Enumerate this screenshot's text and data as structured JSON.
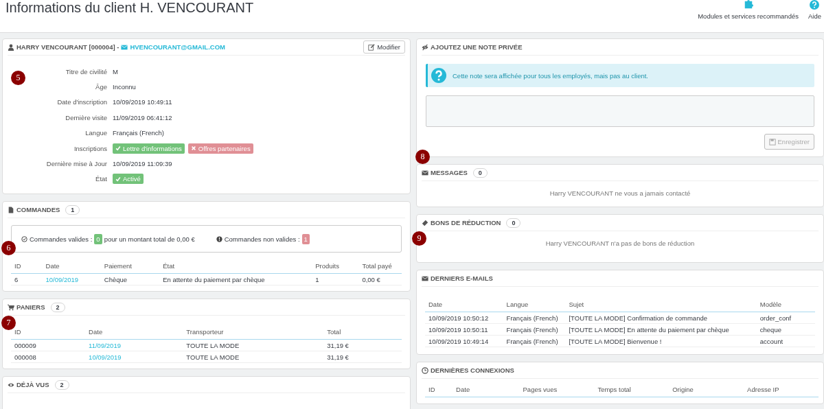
{
  "page": {
    "title": "Informations du client H. VENCOURANT",
    "toolbar": [
      {
        "kind": "puzzle",
        "label": "Modules et services recommandés"
      },
      {
        "kind": "help",
        "label": "Aide"
      }
    ]
  },
  "customer": {
    "name": "HARRY VENCOURANT [000004] -",
    "email": "HVENCOURANT@GMAIL.COM",
    "edit_button": "Modifier",
    "marker": "5",
    "fields": [
      {
        "label": "Titre de civilité",
        "kind": "text",
        "value": "M"
      },
      {
        "label": "Âge",
        "kind": "text",
        "value": "Inconnu"
      },
      {
        "label": "Date d'inscription",
        "kind": "text",
        "value": "10/09/2019 10:49:11"
      },
      {
        "label": "Dernière visite",
        "kind": "text",
        "value": "11/09/2019 06:41:12"
      },
      {
        "label": "Langue",
        "kind": "text",
        "value": "Français (French)"
      },
      {
        "label": "Inscriptions",
        "kind": "badges",
        "badges": [
          {
            "text": "Lettre d'informations",
            "on": true
          },
          {
            "text": "Offres partenaires",
            "on": false
          }
        ]
      },
      {
        "label": "Dernière mise à Jour",
        "kind": "text",
        "value": "10/09/2019 11:09:39"
      },
      {
        "label": "État",
        "kind": "badges",
        "badges": [
          {
            "text": "Activé",
            "on": true
          }
        ]
      }
    ]
  },
  "orders": {
    "title": "COMMANDES",
    "count": "1",
    "marker": "6",
    "valid_label": "Commandes valides :",
    "valid_count": "0",
    "valid_total": "pour un montant total de 0,00 €",
    "invalid_label": "Commandes non valides :",
    "invalid_count": "1",
    "columns": [
      {
        "label": "ID",
        "kind": "text"
      },
      {
        "label": "Date",
        "kind": "link"
      },
      {
        "label": "Paiement",
        "kind": "text"
      },
      {
        "label": "État",
        "kind": "text"
      },
      {
        "label": "Produits",
        "kind": "text"
      },
      {
        "label": "Total payé",
        "kind": "text"
      }
    ],
    "rows": [
      [
        "6",
        "10/09/2019",
        "Chèque",
        "En attente du paiement par chèque",
        "1",
        "0,00 €"
      ]
    ]
  },
  "carts": {
    "title": "PANIERS",
    "count": "2",
    "marker": "7",
    "columns": [
      {
        "label": "ID",
        "kind": "text"
      },
      {
        "label": "Date",
        "kind": "link"
      },
      {
        "label": "Transporteur",
        "kind": "text"
      },
      {
        "label": "Total",
        "kind": "text"
      }
    ],
    "rows": [
      [
        "000009",
        "11/09/2019",
        "TOUTE LA MODE",
        "31,19 €"
      ],
      [
        "000008",
        "10/09/2019",
        "TOUTE LA MODE",
        "31,19 €"
      ]
    ]
  },
  "viewed": {
    "title": "DÉJÀ VUS",
    "count": "2"
  },
  "note": {
    "title": "AJOUTEZ UNE NOTE PRIVÉE",
    "info": "Cette note sera affichée pour tous les employés, mais pas au client.",
    "save_button": "Enregistrer",
    "save_disabled": true
  },
  "messages": {
    "title": "MESSAGES",
    "count": "0",
    "marker": "8",
    "empty": "Harry VENCOURANT ne vous a jamais contacté"
  },
  "vouchers": {
    "title": "BONS DE RÉDUCTION",
    "count": "0",
    "marker": "9",
    "empty": "Harry VENCOURANT n'a pas de bons de réduction"
  },
  "emails": {
    "title": "DERNIERS E-MAILS",
    "columns": [
      "Date",
      "Langue",
      "Sujet",
      "Modèle"
    ],
    "rows": [
      [
        "10/09/2019 10:50:12",
        "Français (French)",
        "[TOUTE LA MODE] Confirmation de commande",
        "order_conf"
      ],
      [
        "10/09/2019 10:50:11",
        "Français (French)",
        "[TOUTE LA MODE] En attente du paiement par chèque",
        "cheque"
      ],
      [
        "10/09/2019 10:49:14",
        "Français (French)",
        "[TOUTE LA MODE] Bienvenue !",
        "account"
      ]
    ]
  },
  "connections": {
    "title": "DERNIÈRES CONNEXIONS",
    "columns": [
      "ID",
      "Date",
      "Pages vues",
      "Temps total",
      "Origine",
      "Adresse IP"
    ]
  }
}
